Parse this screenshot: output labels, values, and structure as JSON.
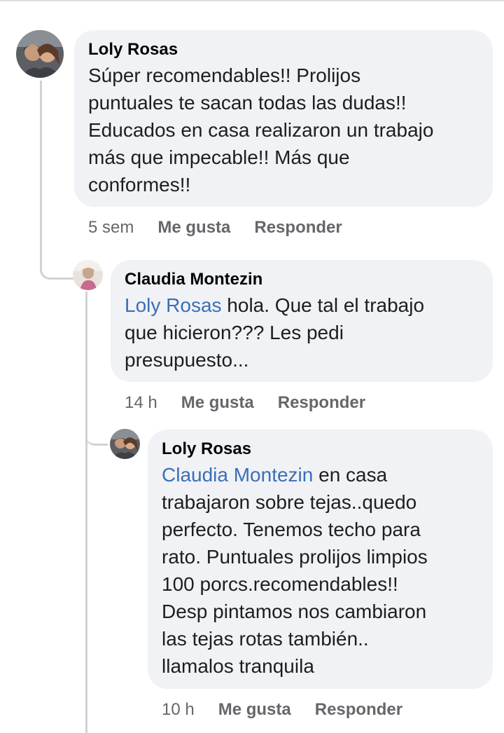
{
  "comments": [
    {
      "author": "Loly Rosas",
      "mention": "",
      "text": "Súper recomendables!! Prolijos\npuntuales te sacan todas las dudas!!\nEducados en casa realizaron un trabajo\nmás que impecable!! Más que\nconformes!!",
      "time": "5 sem",
      "like_label": "Me gusta",
      "reply_label": "Responder"
    },
    {
      "author": "Claudia Montezin",
      "mention": "Loly Rosas",
      "text": " hola. Que tal el trabajo\nque hicieron??? Les pedi\npresupuesto...",
      "time": "14 h",
      "like_label": "Me gusta",
      "reply_label": "Responder"
    },
    {
      "author": "Loly Rosas",
      "mention": "Claudia Montezin",
      "text": " en casa\ntrabajaron sobre tejas..quedo\nperfecto. Tenemos techo para\nrato. Puntuales prolijos limpios\n100 porcs.recomendables!!\nDesp pintamos nos cambiaron\nlas tejas rotas también..\nllamalos tranquila",
      "time": "10 h",
      "like_label": "Me gusta",
      "reply_label": "Responder"
    }
  ],
  "colors": {
    "bubble": "#f0f2f5",
    "mention": "#3b6fb6",
    "meta": "#65676b",
    "thread_line": "#cfd2d6"
  }
}
